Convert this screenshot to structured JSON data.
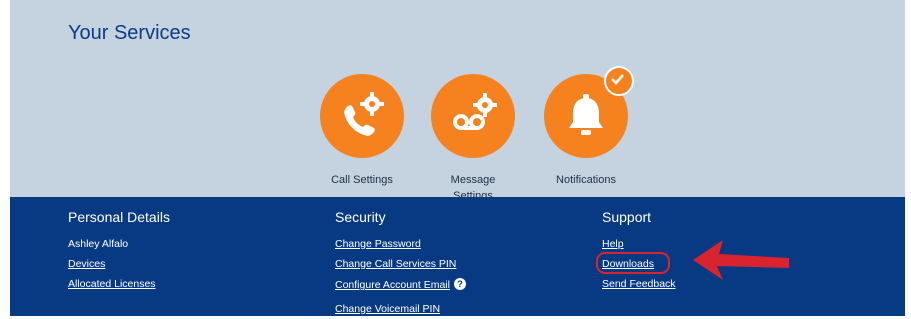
{
  "services": {
    "title": "Your Services",
    "items": [
      {
        "label": "Call Settings",
        "icon": "phone-gear-icon"
      },
      {
        "label": "Message Settings",
        "icon": "voicemail-gear-icon"
      },
      {
        "label": "Notifications",
        "icon": "bell-icon",
        "badge": "checkmark-icon"
      }
    ]
  },
  "footer": {
    "personal": {
      "heading": "Personal Details",
      "name": "Ashley Alfalo",
      "links": [
        "Devices",
        "Allocated Licenses"
      ]
    },
    "security": {
      "heading": "Security",
      "links": [
        "Change Password",
        "Change Call Services PIN",
        "Configure Account Email",
        "Change Voicemail PIN"
      ]
    },
    "support": {
      "heading": "Support",
      "links": [
        "Help",
        "Downloads",
        "Send Feedback"
      ]
    }
  },
  "colors": {
    "services_bg": "#c5d2e0",
    "footer_bg": "#083a84",
    "accent_orange": "#f5821f",
    "annotation_red": "#d9232e"
  }
}
